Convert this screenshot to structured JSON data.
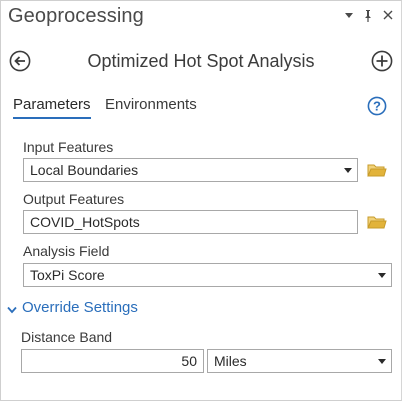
{
  "window": {
    "title": "Geoprocessing",
    "controls": {
      "menu_icon": "dropdown-arrow-icon",
      "pin_icon": "pin-icon",
      "close_icon": "close-icon"
    }
  },
  "tool": {
    "name": "Optimized Hot Spot Analysis",
    "back_icon": "back-arrow-icon",
    "add_icon": "add-icon"
  },
  "tabs": [
    {
      "label": "Parameters",
      "active": true
    },
    {
      "label": "Environments",
      "active": false
    }
  ],
  "help_icon": "help-icon",
  "params": {
    "input_features": {
      "label": "Input Features",
      "value": "Local Boundaries"
    },
    "output_features": {
      "label": "Output Features",
      "value": "COVID_HotSpots"
    },
    "analysis_field": {
      "label": "Analysis Field",
      "value": "ToxPi Score"
    }
  },
  "override": {
    "label": "Override Settings",
    "distance_band": {
      "label": "Distance Band",
      "value": "50",
      "units": "Miles"
    }
  },
  "colors": {
    "accent": "#2a6ebb",
    "folder": "#e2b33a"
  }
}
